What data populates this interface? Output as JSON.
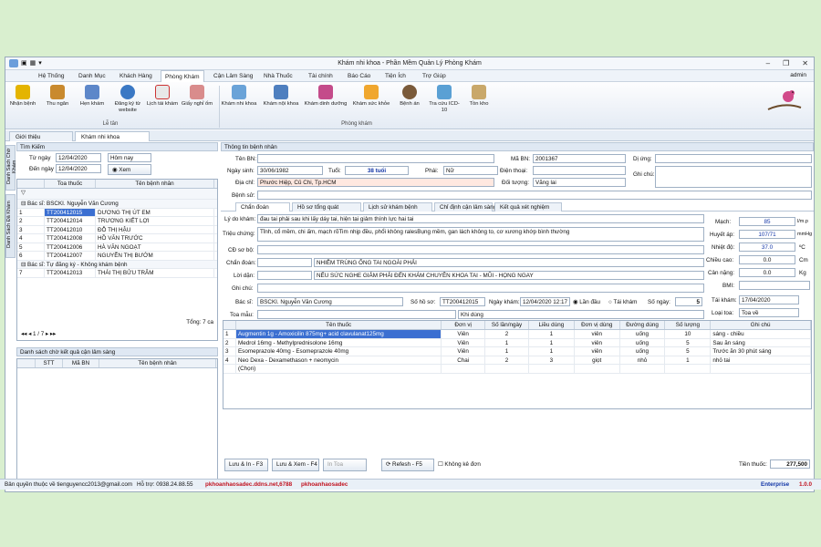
{
  "window": {
    "title": "Khám nhi khoa - Phần Mềm Quản Lý Phòng Khám",
    "user": "admin"
  },
  "menu": [
    "Hệ Thống",
    "Danh Mục",
    "Khách Hàng",
    "Phòng Khám",
    "Cận Lâm Sàng",
    "Nhà Thuốc",
    "Tài chính",
    "Báo Cáo",
    "Tiện Ích",
    "Trợ Giúp"
  ],
  "ribbon": {
    "items": [
      "Nhận bệnh",
      "Thu ngân",
      "Hẹn khám",
      "Đăng ký từ website",
      "Lịch tái khám",
      "Giấy nghỉ ốm",
      "Khám nhi khoa",
      "Khám nội khoa",
      "Khám dinh dưỡng",
      "Khám sức khỏe",
      "Bệnh án",
      "Tra cứu ICD-10",
      "Tồn kho"
    ],
    "groups": [
      "Lễ tân",
      "Phòng khám"
    ]
  },
  "doc_tabs": [
    "Giới thiệu",
    "Khám nhi khoa"
  ],
  "side_tabs": [
    "Danh Sách Chờ Khám",
    "Danh Sách Đã Khám"
  ],
  "search": {
    "title": "Tìm Kiếm",
    "from_label": "Từ ngày",
    "from": "12/04/2020",
    "preset": "Hôm nay",
    "to_label": "Đến ngày",
    "to": "12/04/2020",
    "view_btn": "Xem"
  },
  "patients": {
    "headers": [
      "Toa thuốc",
      "Tên bệnh nhân"
    ],
    "group1": "Bác sĩ: BSCKI. Nguyễn Văn Cương",
    "rows1": [
      [
        "1",
        "TT200412015",
        "DƯƠNG THỊ ÚT EM"
      ],
      [
        "2",
        "TT200412014",
        "TRƯƠNG KIẾT LỢI"
      ],
      [
        "3",
        "TT200412010",
        "ĐỖ THỊ HẬU"
      ],
      [
        "4",
        "TT200412008",
        "HỒ VĂN TRƯỚC"
      ],
      [
        "5",
        "TT200412006",
        "HÀ VĂN NGOẠT"
      ],
      [
        "6",
        "TT200412007",
        "NGUYỄN THỊ BƯỚM"
      ]
    ],
    "group2": "Bác sĩ: Tự đăng ký - Không khám bệnh",
    "rows2": [
      [
        "7",
        "TT200412013",
        "THÁI THỊ BỬU TRÂM"
      ]
    ],
    "total": "Tổng: 7 ca",
    "pager": "1 / 7"
  },
  "lab": {
    "title": "Danh sách chờ kết quả cận lâm sàng",
    "headers": [
      "STT",
      "Mã BN",
      "Tên bệnh nhân"
    ]
  },
  "info": {
    "title": "Thông tin bệnh nhân",
    "name_label": "Tên BN:",
    "code_label": "Mã BN:",
    "code": "2001367",
    "allergy_label": "Dị ứng:",
    "dob_label": "Ngày sinh:",
    "dob": "30/06/1982",
    "age_label": "Tuổi:",
    "age": "38 tuổi",
    "sex_label": "Phái:",
    "sex": "Nữ",
    "phone_label": "Điện thoại:",
    "note_label": "Ghi chú:",
    "addr_label": "Địa chỉ:",
    "addr": "Phước Hiệp, Củ Chi, Tp.HCM",
    "subject_label": "Đối tượng:",
    "subject": "Vãng lai",
    "hx_label": "Bệnh sử:"
  },
  "inner_tabs": [
    "Chẩn đoán",
    "Hồ sơ tổng quát",
    "Lịch sử khám bệnh",
    "Chỉ định cận lâm sàng",
    "Kết quả xét nghiệm"
  ],
  "exam": {
    "reason_label": "Lý do khám:",
    "reason": "đau tai phải sau khi lấy dáy tai, hiện tại giảm thính lực hai tai",
    "symptom_label": "Triệu chứng:",
    "symptom": "Tỉnh, cổ mềm, chi ấm, mạch rõTim nhịp đều, phổi không ralesBụng mềm, gan lách không to, cơ xương khớp bình thường",
    "icd_label": "CĐ sơ bộ:",
    "dx_label": "Chẩn đoán:",
    "dx": "NHIỄM TRÙNG ỐNG TAI NGOÀI PHẢI",
    "advice_label": "Lời dặn:",
    "advice": "NẾU SỨC NGHE GIẢM PHẢI ĐẾN KHÁM CHUYÊN KHOA TAI - MŨI - HỌNG NGAY",
    "note_label": "Ghi chú:",
    "doctor_label": "Bác sĩ:",
    "doctor": "BSCKI. Nguyễn Văn Cương",
    "rec_label": "Số hồ sơ:",
    "rec": "TT200412015",
    "date_label": "Ngày khám:",
    "date": "12/04/2020 12:17",
    "first": "Lần đầu",
    "revisit": "Tái khám",
    "days_label": "Số ngày:",
    "days": "5",
    "template_label": "Toa mẫu:",
    "khidung_label": "Khi dùng"
  },
  "vitals": {
    "pulse_label": "Mạch:",
    "pulse": "85",
    "pulse_unit": "l/m.p",
    "bp_label": "Huyết áp:",
    "bp": "107/71",
    "bp_unit": "mmHg",
    "temp_label": "Nhiệt độ:",
    "temp": "37.0",
    "temp_unit": "ºC",
    "height_label": "Chiều cao:",
    "height": "0.0",
    "height_unit": "Cm",
    "weight_label": "Cân nặng:",
    "weight": "0.0",
    "weight_unit": "Kg",
    "bmi_label": "BMI:",
    "recheck_label": "Tái khám:",
    "recheck": "17/04/2020",
    "type_label": "Loại toa:",
    "type": "Toa về"
  },
  "rx": {
    "headers": [
      "Tên thuốc",
      "Đơn vị",
      "Số lần/ngày",
      "Liều dùng",
      "Đơn vị dùng",
      "Đường dùng",
      "Số lượng",
      "Ghi chú"
    ],
    "rows": [
      [
        "1",
        "Augmentin 1g - Amoxicilin 875mg+ acid clavulanat125mg",
        "Viên",
        "2",
        "1",
        "viên",
        "uống",
        "10",
        "sáng - chiều"
      ],
      [
        "2",
        "Medrol 16mg - Methylprednisolone 16mg",
        "Viên",
        "1",
        "1",
        "viên",
        "uống",
        "5",
        "Sau ăn sáng"
      ],
      [
        "3",
        "Esomeprazole 40mg - Esomeprazole 40mg",
        "Viên",
        "1",
        "1",
        "viên",
        "uống",
        "5",
        "Trước ăn 30 phút sáng"
      ],
      [
        "4",
        "Neo Dexa - Dexamethason + neomycin",
        "Chai",
        "2",
        "3",
        "giọt",
        "nhỏ",
        "1",
        "nhỏ tai"
      ],
      [
        "",
        "(Chọn)",
        "",
        "",
        "",
        "",
        "",
        "",
        ""
      ]
    ]
  },
  "actions": {
    "save_print": "Lưu & In - F3",
    "save_view": "Lưu & Xem - F4",
    "print": "In Toa",
    "refresh": "Refesh - F5",
    "no_rx": "Không kê đơn",
    "total_label": "Tiền thuốc:",
    "total": "277,500"
  },
  "status": {
    "owner": "Bản quyền thuộc về tienguyencc2013@gmail.com",
    "support": "Hỗ trợ: 0938.24.88.55",
    "site": "pkhoanhaosadec.ddns.net,6788",
    "name": "pkhoanhaosadec",
    "edition": "Enterprise",
    "version": "1.0.0"
  }
}
